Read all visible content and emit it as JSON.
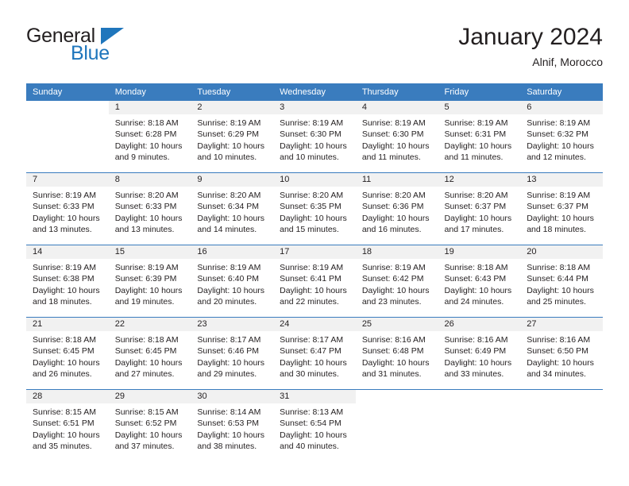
{
  "brand": {
    "name_part1": "General",
    "name_part2": "Blue"
  },
  "header": {
    "month_title": "January 2024",
    "location": "Alnif, Morocco"
  },
  "colors": {
    "header_blue": "#3a7cbe",
    "brand_blue": "#1f76bc",
    "daynum_band": "#f1f1f1",
    "text": "#231f20"
  },
  "weekday_headers": [
    "Sunday",
    "Monday",
    "Tuesday",
    "Wednesday",
    "Thursday",
    "Friday",
    "Saturday"
  ],
  "weeks": [
    [
      {
        "day": "",
        "sunrise": "",
        "sunset": "",
        "daylight1": "",
        "daylight2": "",
        "blank": true
      },
      {
        "day": "1",
        "sunrise": "Sunrise: 8:18 AM",
        "sunset": "Sunset: 6:28 PM",
        "daylight1": "Daylight: 10 hours",
        "daylight2": "and 9 minutes."
      },
      {
        "day": "2",
        "sunrise": "Sunrise: 8:19 AM",
        "sunset": "Sunset: 6:29 PM",
        "daylight1": "Daylight: 10 hours",
        "daylight2": "and 10 minutes."
      },
      {
        "day": "3",
        "sunrise": "Sunrise: 8:19 AM",
        "sunset": "Sunset: 6:30 PM",
        "daylight1": "Daylight: 10 hours",
        "daylight2": "and 10 minutes."
      },
      {
        "day": "4",
        "sunrise": "Sunrise: 8:19 AM",
        "sunset": "Sunset: 6:30 PM",
        "daylight1": "Daylight: 10 hours",
        "daylight2": "and 11 minutes."
      },
      {
        "day": "5",
        "sunrise": "Sunrise: 8:19 AM",
        "sunset": "Sunset: 6:31 PM",
        "daylight1": "Daylight: 10 hours",
        "daylight2": "and 11 minutes."
      },
      {
        "day": "6",
        "sunrise": "Sunrise: 8:19 AM",
        "sunset": "Sunset: 6:32 PM",
        "daylight1": "Daylight: 10 hours",
        "daylight2": "and 12 minutes."
      }
    ],
    [
      {
        "day": "7",
        "sunrise": "Sunrise: 8:19 AM",
        "sunset": "Sunset: 6:33 PM",
        "daylight1": "Daylight: 10 hours",
        "daylight2": "and 13 minutes."
      },
      {
        "day": "8",
        "sunrise": "Sunrise: 8:20 AM",
        "sunset": "Sunset: 6:33 PM",
        "daylight1": "Daylight: 10 hours",
        "daylight2": "and 13 minutes."
      },
      {
        "day": "9",
        "sunrise": "Sunrise: 8:20 AM",
        "sunset": "Sunset: 6:34 PM",
        "daylight1": "Daylight: 10 hours",
        "daylight2": "and 14 minutes."
      },
      {
        "day": "10",
        "sunrise": "Sunrise: 8:20 AM",
        "sunset": "Sunset: 6:35 PM",
        "daylight1": "Daylight: 10 hours",
        "daylight2": "and 15 minutes."
      },
      {
        "day": "11",
        "sunrise": "Sunrise: 8:20 AM",
        "sunset": "Sunset: 6:36 PM",
        "daylight1": "Daylight: 10 hours",
        "daylight2": "and 16 minutes."
      },
      {
        "day": "12",
        "sunrise": "Sunrise: 8:20 AM",
        "sunset": "Sunset: 6:37 PM",
        "daylight1": "Daylight: 10 hours",
        "daylight2": "and 17 minutes."
      },
      {
        "day": "13",
        "sunrise": "Sunrise: 8:19 AM",
        "sunset": "Sunset: 6:37 PM",
        "daylight1": "Daylight: 10 hours",
        "daylight2": "and 18 minutes."
      }
    ],
    [
      {
        "day": "14",
        "sunrise": "Sunrise: 8:19 AM",
        "sunset": "Sunset: 6:38 PM",
        "daylight1": "Daylight: 10 hours",
        "daylight2": "and 18 minutes."
      },
      {
        "day": "15",
        "sunrise": "Sunrise: 8:19 AM",
        "sunset": "Sunset: 6:39 PM",
        "daylight1": "Daylight: 10 hours",
        "daylight2": "and 19 minutes."
      },
      {
        "day": "16",
        "sunrise": "Sunrise: 8:19 AM",
        "sunset": "Sunset: 6:40 PM",
        "daylight1": "Daylight: 10 hours",
        "daylight2": "and 20 minutes."
      },
      {
        "day": "17",
        "sunrise": "Sunrise: 8:19 AM",
        "sunset": "Sunset: 6:41 PM",
        "daylight1": "Daylight: 10 hours",
        "daylight2": "and 22 minutes."
      },
      {
        "day": "18",
        "sunrise": "Sunrise: 8:19 AM",
        "sunset": "Sunset: 6:42 PM",
        "daylight1": "Daylight: 10 hours",
        "daylight2": "and 23 minutes."
      },
      {
        "day": "19",
        "sunrise": "Sunrise: 8:18 AM",
        "sunset": "Sunset: 6:43 PM",
        "daylight1": "Daylight: 10 hours",
        "daylight2": "and 24 minutes."
      },
      {
        "day": "20",
        "sunrise": "Sunrise: 8:18 AM",
        "sunset": "Sunset: 6:44 PM",
        "daylight1": "Daylight: 10 hours",
        "daylight2": "and 25 minutes."
      }
    ],
    [
      {
        "day": "21",
        "sunrise": "Sunrise: 8:18 AM",
        "sunset": "Sunset: 6:45 PM",
        "daylight1": "Daylight: 10 hours",
        "daylight2": "and 26 minutes."
      },
      {
        "day": "22",
        "sunrise": "Sunrise: 8:18 AM",
        "sunset": "Sunset: 6:45 PM",
        "daylight1": "Daylight: 10 hours",
        "daylight2": "and 27 minutes."
      },
      {
        "day": "23",
        "sunrise": "Sunrise: 8:17 AM",
        "sunset": "Sunset: 6:46 PM",
        "daylight1": "Daylight: 10 hours",
        "daylight2": "and 29 minutes."
      },
      {
        "day": "24",
        "sunrise": "Sunrise: 8:17 AM",
        "sunset": "Sunset: 6:47 PM",
        "daylight1": "Daylight: 10 hours",
        "daylight2": "and 30 minutes."
      },
      {
        "day": "25",
        "sunrise": "Sunrise: 8:16 AM",
        "sunset": "Sunset: 6:48 PM",
        "daylight1": "Daylight: 10 hours",
        "daylight2": "and 31 minutes."
      },
      {
        "day": "26",
        "sunrise": "Sunrise: 8:16 AM",
        "sunset": "Sunset: 6:49 PM",
        "daylight1": "Daylight: 10 hours",
        "daylight2": "and 33 minutes."
      },
      {
        "day": "27",
        "sunrise": "Sunrise: 8:16 AM",
        "sunset": "Sunset: 6:50 PM",
        "daylight1": "Daylight: 10 hours",
        "daylight2": "and 34 minutes."
      }
    ],
    [
      {
        "day": "28",
        "sunrise": "Sunrise: 8:15 AM",
        "sunset": "Sunset: 6:51 PM",
        "daylight1": "Daylight: 10 hours",
        "daylight2": "and 35 minutes."
      },
      {
        "day": "29",
        "sunrise": "Sunrise: 8:15 AM",
        "sunset": "Sunset: 6:52 PM",
        "daylight1": "Daylight: 10 hours",
        "daylight2": "and 37 minutes."
      },
      {
        "day": "30",
        "sunrise": "Sunrise: 8:14 AM",
        "sunset": "Sunset: 6:53 PM",
        "daylight1": "Daylight: 10 hours",
        "daylight2": "and 38 minutes."
      },
      {
        "day": "31",
        "sunrise": "Sunrise: 8:13 AM",
        "sunset": "Sunset: 6:54 PM",
        "daylight1": "Daylight: 10 hours",
        "daylight2": "and 40 minutes."
      },
      {
        "day": "",
        "sunrise": "",
        "sunset": "",
        "daylight1": "",
        "daylight2": "",
        "blank": true
      },
      {
        "day": "",
        "sunrise": "",
        "sunset": "",
        "daylight1": "",
        "daylight2": "",
        "blank": true
      },
      {
        "day": "",
        "sunrise": "",
        "sunset": "",
        "daylight1": "",
        "daylight2": "",
        "blank": true
      }
    ]
  ]
}
